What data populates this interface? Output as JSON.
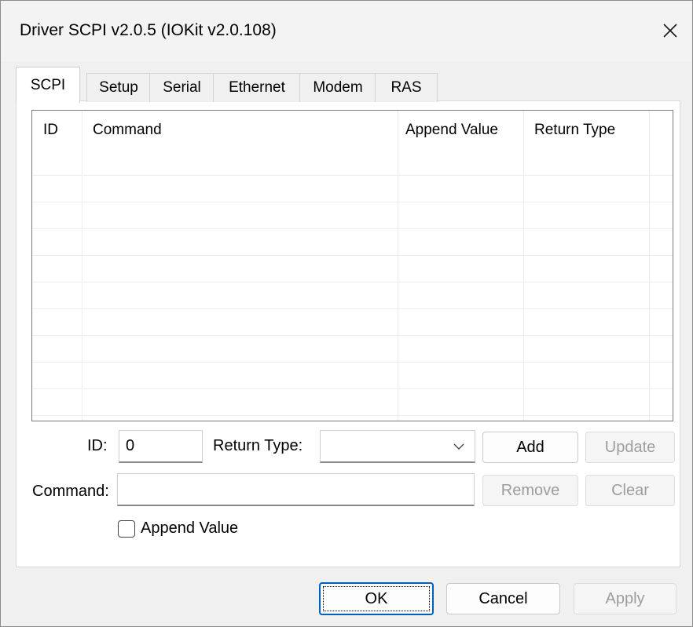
{
  "window": {
    "title": "Driver SCPI v2.0.5 (IOKit v2.0.108)"
  },
  "tabs": [
    {
      "label": "SCPI",
      "active": true
    },
    {
      "label": "Setup"
    },
    {
      "label": "Serial"
    },
    {
      "label": "Ethernet"
    },
    {
      "label": "Modem"
    },
    {
      "label": "RAS"
    }
  ],
  "list": {
    "columns": [
      "ID",
      "Command",
      "Append Value",
      "Return Type"
    ],
    "rows": []
  },
  "form": {
    "id_label": "ID:",
    "id_value": "0",
    "return_type_label": "Return Type:",
    "return_type_value": "",
    "command_label": "Command:",
    "command_value": "",
    "append_value_label": "Append Value",
    "append_value_checked": false,
    "add_label": "Add",
    "update_label": "Update",
    "remove_label": "Remove",
    "clear_label": "Clear"
  },
  "buttons": {
    "ok": "OK",
    "cancel": "Cancel",
    "apply": "Apply"
  }
}
